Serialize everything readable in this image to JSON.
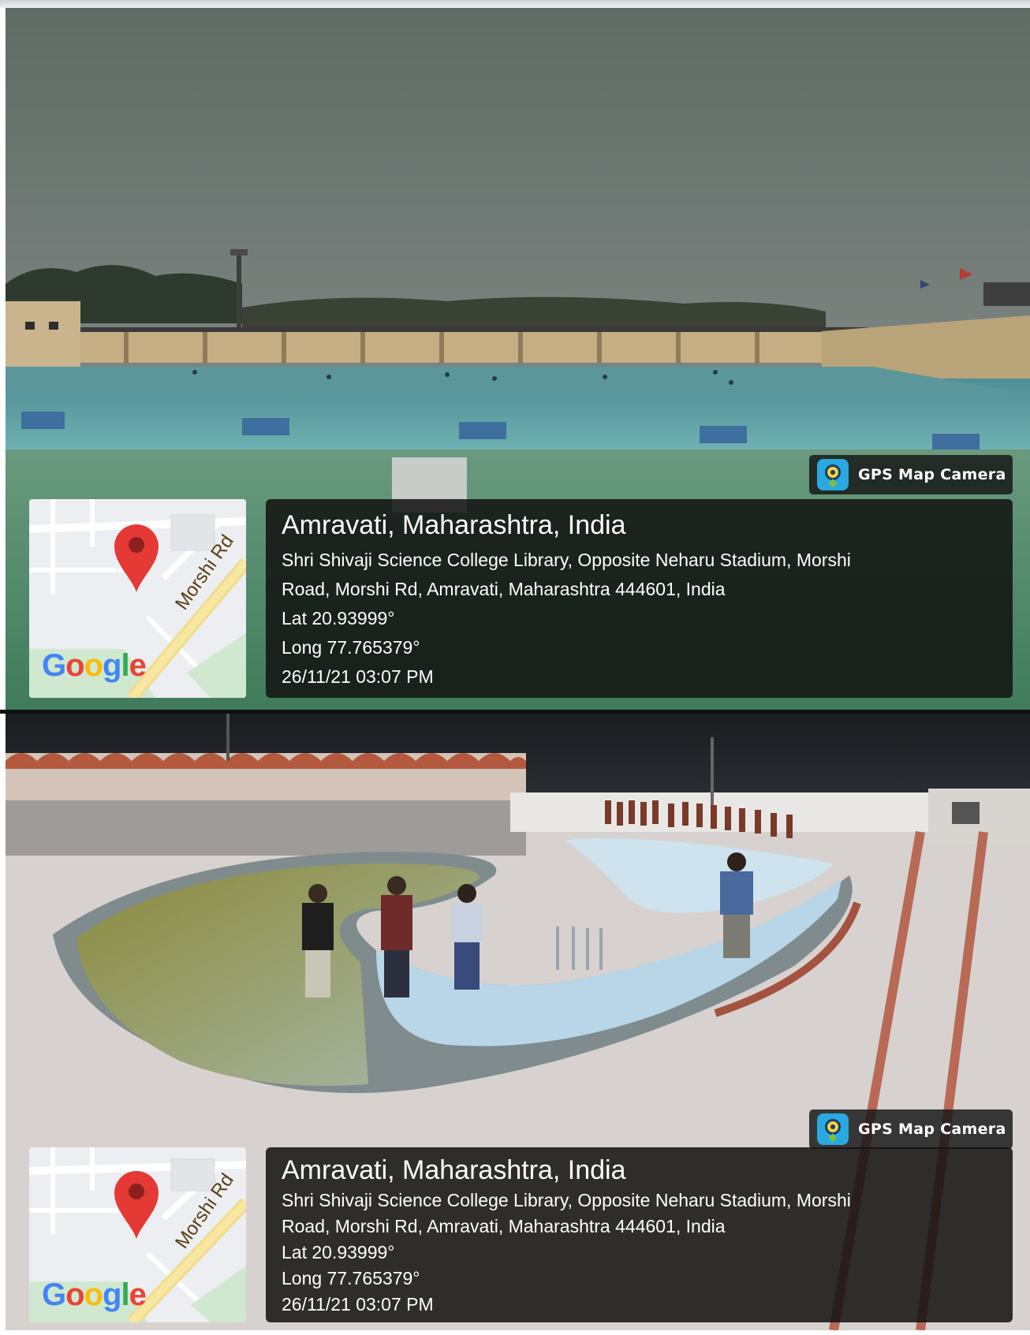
{
  "stamps": [
    {
      "badge_label": "GPS Map Camera",
      "map_road_label": "Morshi Rd",
      "map_logo": "Google",
      "location_title": "Amravati, Maharashtra, India",
      "address_line1": "Shri Shivaji Science College Library, Opposite Neharu Stadium, Morshi",
      "address_line2": "Road, Morshi Rd, Amravati, Maharashtra 444601, India",
      "latitude": "Lat 20.93999°",
      "longitude": "Long 77.765379°",
      "datetime": "26/11/21 03:07 PM"
    },
    {
      "badge_label": "GPS Map Camera",
      "map_road_label": "Morshi Rd",
      "map_logo": "Google",
      "location_title": "Amravati, Maharashtra, India",
      "address_line1": "Shri Shivaji Science College Library, Opposite Neharu Stadium, Morshi",
      "address_line2": "Road, Morshi Rd, Amravati, Maharashtra 444601, India",
      "latitude": "Lat 20.93999°",
      "longitude": "Long 77.765379°",
      "datetime": "26/11/21 03:07 PM"
    }
  ],
  "icons": {
    "badge": "gps-map-camera-icon",
    "map_pin": "map-pin-icon"
  },
  "colors": {
    "pin_red": "#e53935",
    "google_blue": "#4285F4",
    "google_red": "#EA4335",
    "google_yellow": "#FBBC05",
    "google_green": "#34A853",
    "overlay": "#121212"
  }
}
